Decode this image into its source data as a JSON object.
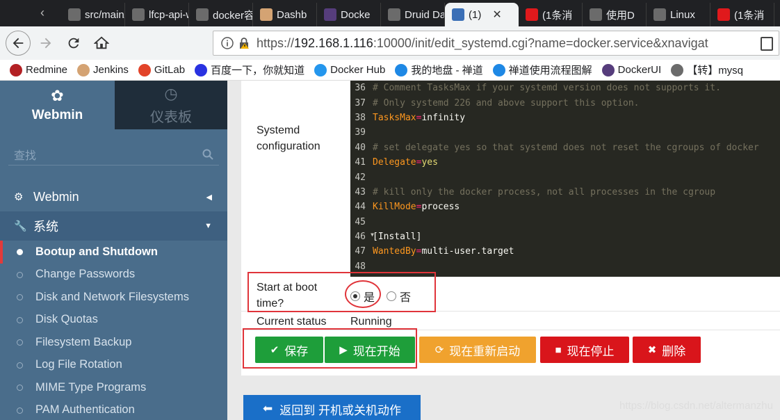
{
  "browser": {
    "tabs": [
      {
        "label": "src/main/",
        "icon": "gitlab-icon",
        "color": "#6b6b6b"
      },
      {
        "label": "lfcp-api-w",
        "icon": "gitlab-icon",
        "color": "#6b6b6b"
      },
      {
        "label": "docker容器",
        "icon": "docker-icon",
        "color": "#6b6b6b"
      },
      {
        "label": "Dashb",
        "icon": "jenkins-icon",
        "color": "#d4a373"
      },
      {
        "label": "Docke",
        "icon": "bootstrap-icon",
        "color": "#563d7c"
      },
      {
        "label": "Druid Dat",
        "icon": "druid-icon",
        "color": "#6b6b6b"
      },
      {
        "label": "(1)",
        "icon": "webmin-icon",
        "color": "#3b6fb6"
      },
      {
        "label": "(1条消",
        "icon": "csdn-icon",
        "color": "#e0191c"
      },
      {
        "label": "使用D",
        "icon": "linux-icon",
        "color": "#6b6b6b"
      },
      {
        "label": "Linux",
        "icon": "linux-icon",
        "color": "#6b6b6b"
      },
      {
        "label": "(1条消",
        "icon": "csdn-icon",
        "color": "#e0191c"
      }
    ],
    "url_scheme": "https://",
    "url_host": "192.168.1.116",
    "url_rest": ":10000/init/edit_systemd.cgi?name=docker.service&xnavigat",
    "bookmarks": [
      {
        "label": "Redmine",
        "icon": "redmine-icon",
        "color": "#b32024"
      },
      {
        "label": "Jenkins",
        "icon": "jenkins-icon",
        "color": "#d4a373"
      },
      {
        "label": "GitLab",
        "icon": "gitlab-icon",
        "color": "#e24329"
      },
      {
        "label": "百度一下，你就知道",
        "icon": "baidu-icon",
        "color": "#2932e1"
      },
      {
        "label": "Docker Hub",
        "icon": "docker-icon",
        "color": "#2496ed"
      },
      {
        "label": "我的地盘 - 禅道",
        "icon": "zentao-icon",
        "color": "#1e88e5"
      },
      {
        "label": "禅道使用流程图解",
        "icon": "zentao-icon",
        "color": "#1e88e5"
      },
      {
        "label": "DockerUI",
        "icon": "bootstrap-icon",
        "color": "#563d7c"
      },
      {
        "label": "【转】mysq",
        "icon": "linux-icon",
        "color": "#6b6b6b"
      }
    ]
  },
  "sidebar": {
    "brand": "Webmin",
    "dashboard": "仪表板",
    "search_placeholder": "查找",
    "menu_webmin": "Webmin",
    "menu_system": "系统",
    "sub_items": [
      "Bootup and Shutdown",
      "Change Passwords",
      "Disk and Network Filesystems",
      "Disk Quotas",
      "Filesystem Backup",
      "Log File Rotation",
      "MIME Type Programs",
      "PAM Authentication"
    ]
  },
  "form": {
    "systemd_label_1": "Systemd",
    "systemd_label_2": "configuration",
    "boot_label_1": "Start at boot",
    "boot_label_2": "time?",
    "boot_yes": "是",
    "boot_no": "否",
    "status_label": "Current status",
    "status_value": "Running"
  },
  "editor_lines": [
    {
      "n": "36",
      "parts": [
        [
          "cm",
          "# Comment TasksMax if your systemd version does not supports it."
        ]
      ]
    },
    {
      "n": "37",
      "parts": [
        [
          "cm",
          "# Only systemd 226 and above support this option."
        ]
      ]
    },
    {
      "n": "38",
      "parts": [
        [
          "key",
          "TasksMax"
        ],
        [
          "op",
          "="
        ],
        [
          "val",
          "infinity"
        ]
      ]
    },
    {
      "n": "39",
      "parts": []
    },
    {
      "n": "40",
      "parts": [
        [
          "cm",
          "# set delegate yes so that systemd does not reset the cgroups of docker"
        ]
      ]
    },
    {
      "n": "41",
      "parts": [
        [
          "key",
          "Delegate"
        ],
        [
          "op",
          "="
        ],
        [
          "yes",
          "yes"
        ]
      ]
    },
    {
      "n": "42",
      "parts": []
    },
    {
      "n": "43",
      "parts": [
        [
          "cm",
          "# kill only the docker process, not all processes in the cgroup"
        ]
      ]
    },
    {
      "n": "44",
      "parts": [
        [
          "key",
          "KillMode"
        ],
        [
          "op",
          "="
        ],
        [
          "val",
          "process"
        ]
      ]
    },
    {
      "n": "45",
      "parts": []
    },
    {
      "n": "46",
      "fold": true,
      "parts": [
        [
          "val",
          "[Install]"
        ]
      ]
    },
    {
      "n": "47",
      "parts": [
        [
          "key",
          "WantedBy"
        ],
        [
          "op",
          "="
        ],
        [
          "val",
          "multi-user.target"
        ]
      ]
    },
    {
      "n": "48",
      "parts": []
    }
  ],
  "buttons": {
    "save": "保存",
    "start": "现在开始",
    "restart": "现在重新启动",
    "stop": "现在停止",
    "delete": "删除",
    "return": "返回到 开机或关机动作"
  },
  "colors": {
    "save": "#1e9e3a",
    "start": "#1e9e3a",
    "restart": "#f0a22e",
    "stop": "#d9151b",
    "delete": "#d9151b",
    "return": "#1a6fc8",
    "annotation": "#e0343a"
  },
  "watermark": "https://blog.csdn.net/altermanzhu"
}
